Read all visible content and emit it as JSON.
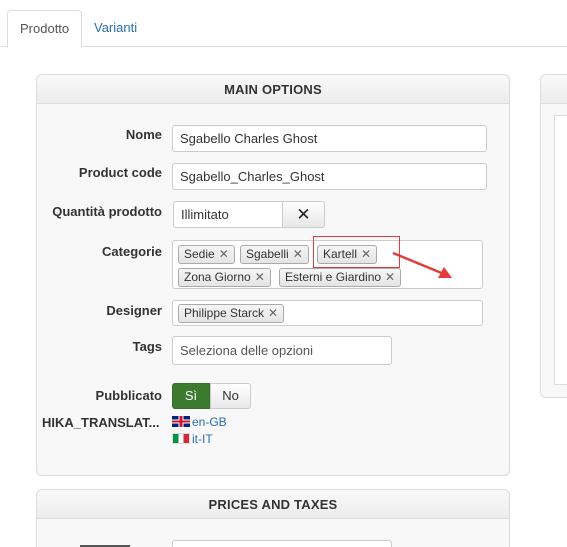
{
  "tabs": [
    {
      "label": "Prodotto",
      "active": true
    },
    {
      "label": "Varianti",
      "active": false
    }
  ],
  "main_options": {
    "title": "MAIN OPTIONS",
    "nome": {
      "label": "Nome",
      "value": "Sgabello Charles Ghost"
    },
    "product_code": {
      "label": "Product code",
      "value": "Sgabello_Charles_Ghost"
    },
    "quantita": {
      "label": "Quantità prodotto",
      "value": "Illimitato",
      "clear_icon": "close-icon"
    },
    "categorie": {
      "label": "Categorie",
      "chips": [
        "Sedie",
        "Sgabelli",
        "Kartell",
        "Zona Giorno",
        "Esterni e Giardino"
      ]
    },
    "designer": {
      "label": "Designer",
      "chips": [
        "Philippe Starck"
      ]
    },
    "tags": {
      "label": "Tags",
      "placeholder": "Seleziona delle opzioni"
    },
    "pubblicato": {
      "label": "Pubblicato",
      "yes": "Sì",
      "no": "No",
      "value": "Sì"
    },
    "translations": {
      "label": "HIKA_TRANSLAT...",
      "languages": [
        {
          "code": "en-GB",
          "flag": "uk-flag-icon"
        },
        {
          "code": "it-IT",
          "flag": "italy-flag-icon"
        }
      ]
    }
  },
  "prices": {
    "title": "PRICES AND TAXES"
  },
  "colors": {
    "accent_link": "#2a6fb5",
    "toggle_on": "#3b7a2f",
    "annotation": "#e03c3c"
  }
}
